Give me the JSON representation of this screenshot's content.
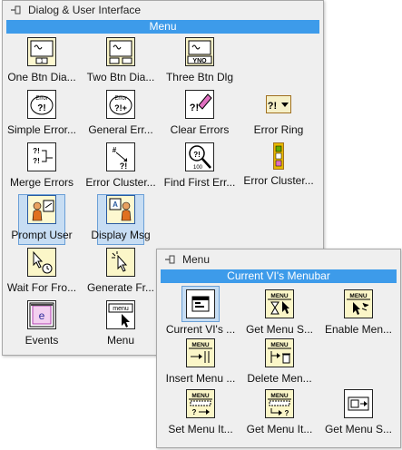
{
  "main_palette": {
    "title": "Dialog & User Interface",
    "category": "Menu",
    "items": [
      {
        "label": "One Btn Dia...",
        "icon": "one-button-dialog-icon"
      },
      {
        "label": "Two Btn Dia...",
        "icon": "two-button-dialog-icon"
      },
      {
        "label": "Three Btn Dlg",
        "icon": "three-button-dialog-icon"
      },
      {
        "label": "Simple Error...",
        "icon": "simple-error-handler-icon"
      },
      {
        "label": "General Err...",
        "icon": "general-error-handler-icon"
      },
      {
        "label": "Clear Errors",
        "icon": "clear-errors-icon"
      },
      {
        "label": "Error Ring",
        "icon": "error-ring-icon"
      },
      {
        "label": "Merge Errors",
        "icon": "merge-errors-icon"
      },
      {
        "label": "Error Cluster...",
        "icon": "error-cluster-from-code-icon"
      },
      {
        "label": "Find First Err...",
        "icon": "find-first-error-icon"
      },
      {
        "label": "Error Cluster...",
        "icon": "error-cluster-constant-icon"
      },
      {
        "label": "Prompt User",
        "icon": "prompt-user-icon"
      },
      {
        "label": "Display Msg",
        "icon": "display-message-icon"
      },
      {
        "label": "Wait For Fro...",
        "icon": "wait-for-front-panel-icon"
      },
      {
        "label": "Generate Fr...",
        "icon": "generate-front-panel-activity-icon"
      },
      {
        "label": "Events",
        "icon": "events-icon"
      },
      {
        "label": "Menu",
        "icon": "menu-icon"
      }
    ]
  },
  "sub_palette": {
    "title": "Menu",
    "category": "Current VI's Menubar",
    "items": [
      {
        "label": "Current VI's ...",
        "icon": "current-vi-menubar-icon"
      },
      {
        "label": "Get Menu S...",
        "icon": "get-menu-selection-icon"
      },
      {
        "label": "Enable Men...",
        "icon": "enable-menu-tracking-icon"
      },
      {
        "label": "Insert Menu ...",
        "icon": "insert-menu-items-icon"
      },
      {
        "label": "Delete Men...",
        "icon": "delete-menu-items-icon"
      },
      {
        "label": "Set Menu It...",
        "icon": "set-menu-item-info-icon"
      },
      {
        "label": "Get Menu It...",
        "icon": "get-menu-item-info-icon"
      },
      {
        "label": "Get Menu S...",
        "icon": "get-menu-shortcut-info-icon"
      }
    ]
  },
  "icon_text": {
    "menu": "MENU",
    "menu_lower": "menu",
    "error": "Error",
    "yno": "YNO",
    "question_bang": "?!",
    "e": "e"
  }
}
